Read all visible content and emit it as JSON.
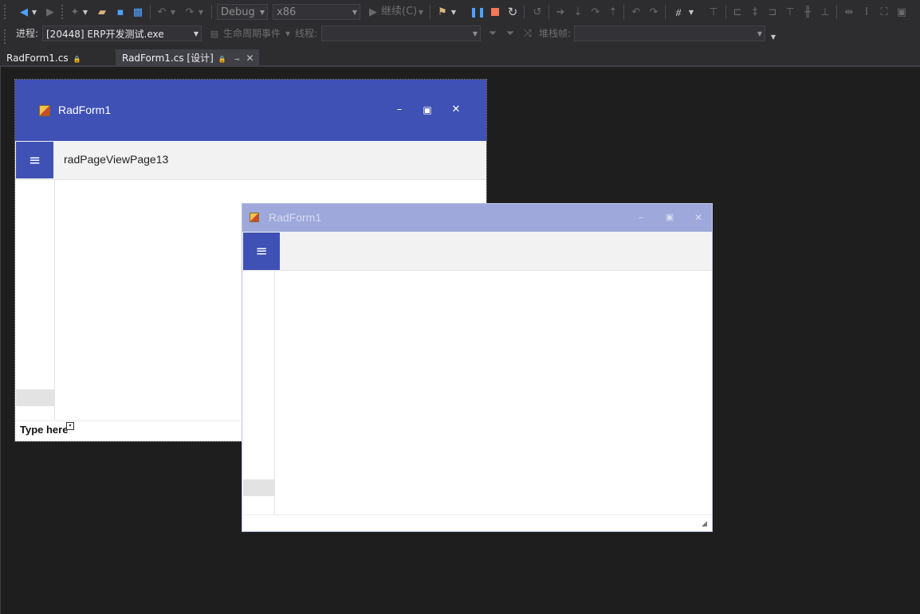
{
  "toolbar": {
    "config_combo": "Debug",
    "platform_combo": "x86",
    "continue_label": "继续(C)",
    "buttons": [
      "back-icon",
      "forward-icon",
      "new-item-icon",
      "open-folder-icon",
      "save-icon",
      "save-all-icon",
      "undo-icon",
      "redo-icon"
    ]
  },
  "debug_toolbar": {
    "process_label": "进程:",
    "process_value": "[20448] ERP开发测试.exe",
    "lifecycle_label": "生命周期事件",
    "thread_label": "线程:",
    "thread_value": "",
    "stackframe_label": "堆栈帧:",
    "stackframe_value": ""
  },
  "tabs": [
    {
      "label": "RadForm1.cs",
      "active": false
    },
    {
      "label": "RadForm1.cs [设计]",
      "active": true
    }
  ],
  "form_back": {
    "title": "RadForm1",
    "page_label": "radPageViewPage13",
    "footer_text": "Type here",
    "title_color": "#3f51b5"
  },
  "form_front": {
    "title": "RadForm1",
    "title_color": "#9ea8db"
  },
  "colors": {
    "ide_background": "#1e1e1e",
    "toolbar": "#2d2d30",
    "pause": "#4fa2ff",
    "stop": "#f2785a"
  }
}
